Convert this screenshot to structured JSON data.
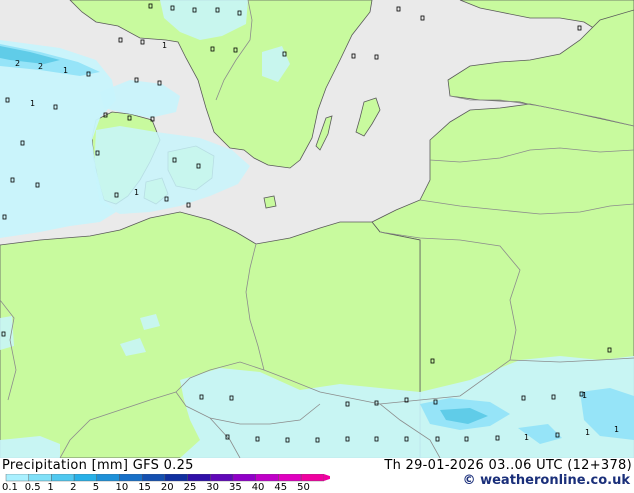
{
  "header": {
    "left_title": "Precipitation [mm]  GFS 0.25",
    "right_title": "Th 29-01-2026 03..06 UTC (12+378)"
  },
  "footer": {
    "credit": "© weatheronline.co.uk"
  },
  "legend": {
    "ticks": [
      "0.1",
      "0.5",
      "1",
      "2",
      "5",
      "10",
      "15",
      "20",
      "25",
      "30",
      "35",
      "40",
      "45",
      "50"
    ],
    "colors": [
      "#aaf0ff",
      "#80e0f8",
      "#50c8f0",
      "#28b0e8",
      "#1e90d8",
      "#1870c8",
      "#1450b0",
      "#1030a0",
      "#3010a8",
      "#6008b8",
      "#9000c8",
      "#c000c8",
      "#e000c0",
      "#f000a0"
    ]
  },
  "map_colors": {
    "sea": "#eaeaea",
    "land": "#c8fa9e",
    "precip_light": "#c8f4fc",
    "precip_medium": "#96e4f8",
    "precip_heavy": "#60cce8",
    "border": "#8c8c8c",
    "coast": "#5a5a5a"
  },
  "map_labels": {
    "precip_values": [
      "2",
      "2",
      "1",
      "1",
      "1",
      "1",
      "1",
      "1",
      "1",
      "1"
    ]
  }
}
